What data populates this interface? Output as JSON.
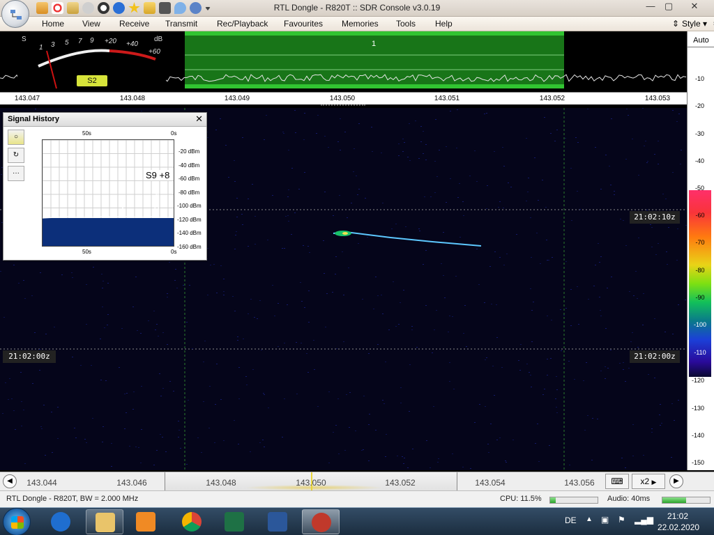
{
  "window": {
    "title": "RTL Dongle - R820T :: SDR Console v3.0.19",
    "controls": {
      "minimize": "—",
      "maximize": "▢",
      "close": "✕"
    }
  },
  "quick_access": [
    "home-icon",
    "lifebuoy-icon",
    "folder-icon",
    "play-icon",
    "stop-icon",
    "plus-icon",
    "star-icon",
    "lock-icon",
    "camera-icon",
    "dropper-icon",
    "undo-icon",
    "dropdown-icon"
  ],
  "menu": {
    "items": [
      "Home",
      "View",
      "Receive",
      "Transmit",
      "Rec/Playback",
      "Favourites",
      "Memories",
      "Tools",
      "Help"
    ],
    "style_label": "Style"
  },
  "smeter": {
    "s_label": "S",
    "db_label": "dB",
    "scale": [
      "1",
      "3",
      "5",
      "7",
      "9",
      "+20",
      "+40",
      "+60"
    ],
    "reading": "S2"
  },
  "spectrum": {
    "marker_label": "1",
    "ticks": [
      "143.047",
      "143.048",
      "143.049",
      "143.050",
      "143.051",
      "143.052",
      "143.053"
    ]
  },
  "right_scale": {
    "auto_label": "Auto",
    "ticks": [
      "-10",
      "-20",
      "-30",
      "-40",
      "-50",
      "-60",
      "-70",
      "-80",
      "-90",
      "-100",
      "-110",
      "-120",
      "-130",
      "-140",
      "-150"
    ],
    "color_ticks": [
      "-60",
      "-70",
      "-80",
      "-90",
      "-100",
      "-110"
    ]
  },
  "waterfall": {
    "time_labels": [
      "21:02:10z",
      "21:02:00z",
      "21:02:00z"
    ]
  },
  "signal_history": {
    "title": "Signal History",
    "close": "✕",
    "buttons": [
      "○",
      "↻",
      "···"
    ],
    "top_left": "50s",
    "top_right": "0s",
    "bottom_left": "50s",
    "bottom_right": "0s",
    "reading": "S9 +8",
    "y_labels": [
      "-20 dBm",
      "-40 dBm",
      "-60 dBm",
      "-80 dBm",
      "-100 dBm",
      "-120 dBm",
      "-140 dBm",
      "-160 dBm"
    ]
  },
  "freq_bar": {
    "ticks": [
      "143.044",
      "143.046",
      "143.048",
      "143.050",
      "143.052",
      "143.054",
      "143.056"
    ],
    "left_btn": "◀",
    "right_btn": "▶",
    "zoom_label": "x2",
    "keyboard": "⌨"
  },
  "status": {
    "device": "RTL Dongle - R820T, BW = 2.000 MHz",
    "cpu": "CPU: 11.5%",
    "cpu_level": 0.115,
    "audio": "Audio: 40ms",
    "audio_level": 0.5
  },
  "taskbar": {
    "apps": [
      "internet-explorer-icon",
      "file-explorer-icon",
      "media-player-icon",
      "chrome-icon",
      "excel-icon",
      "word-icon",
      "sdr-console-icon"
    ],
    "lang": "DE",
    "time": "21:02",
    "date": "22.02.2020"
  },
  "colors": {
    "spectrum_band": "#1fa31f",
    "waterfall_bg": "#05051a",
    "smeter_needle": "#cc1111",
    "smeter_badge": "#d7e43a"
  }
}
